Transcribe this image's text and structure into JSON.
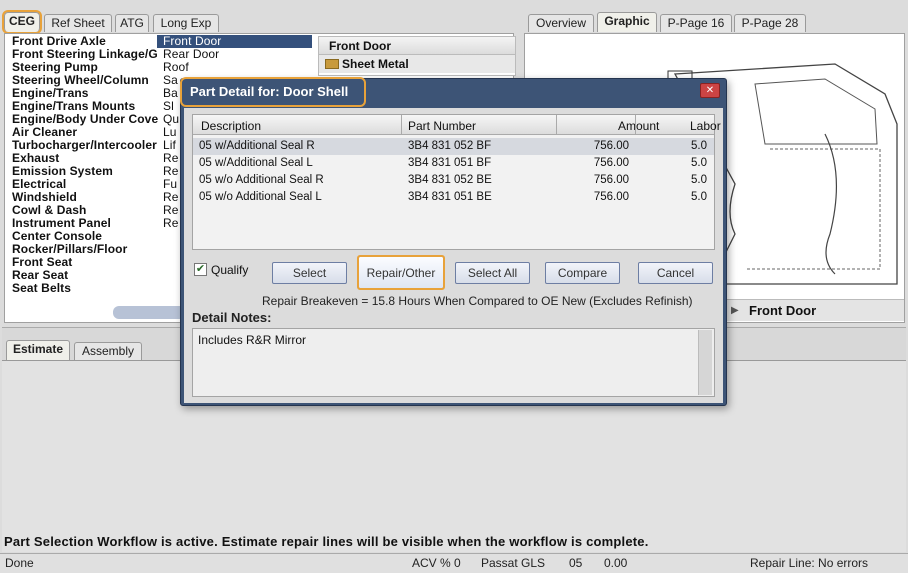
{
  "top_tabs": [
    "CEG",
    "Ref Sheet",
    "ATG",
    "Long Exp"
  ],
  "view_tabs": [
    "Overview",
    "Graphic",
    "P-Page 16",
    "P-Page 28"
  ],
  "categories": [
    "Front Drive Axle",
    "Front Steering Linkage/G",
    "Steering Pump",
    "Steering Wheel/Column",
    "Engine/Trans",
    "Engine/Trans Mounts",
    "Engine/Body Under Cove",
    "Air Cleaner",
    "Turbocharger/Intercooler",
    "Exhaust",
    "Emission System",
    "Electrical",
    "Windshield",
    "Cowl & Dash",
    "Instrument Panel",
    "Center Console",
    "Rocker/Pillars/Floor",
    "Front Seat",
    "Rear Seat",
    "Seat Belts"
  ],
  "subcategories": [
    "Front Door",
    "Rear Door",
    "Roof",
    "Sa",
    "Ba",
    "Sl",
    "Qu",
    "Lu",
    "Lif",
    "Re",
    "Re",
    "Fu",
    "Re",
    "Re",
    "Re"
  ],
  "tree": {
    "header": "Front Door",
    "item": "Sheet Metal"
  },
  "graphic": {
    "caption": "Front Door"
  },
  "bottom_tabs": [
    "Estimate",
    "Assembly"
  ],
  "workflow_message": "Part Selection Workflow is active. Estimate repair lines will be visible when the workflow is complete.",
  "status": {
    "left": "Done",
    "acv": "ACV % 0",
    "model": "Passat GLS",
    "year": "05",
    "amount": "0.00",
    "repair": "Repair Line: No errors"
  },
  "dialog": {
    "title": "Part Detail for: Door Shell",
    "columns": [
      "Description",
      "Part Number",
      "Amount",
      "Labor"
    ],
    "rows": [
      {
        "desc": "05 w/Additional Seal R",
        "part": "3B4 831 052 BF",
        "amount": "756.00",
        "labor": "5.0"
      },
      {
        "desc": "05 w/Additional Seal L",
        "part": "3B4 831 051 BF",
        "amount": "756.00",
        "labor": "5.0"
      },
      {
        "desc": "05 w/o Additional Seal R",
        "part": "3B4 831 052 BE",
        "amount": "756.00",
        "labor": "5.0"
      },
      {
        "desc": "05 w/o Additional Seal L",
        "part": "3B4 831 051 BE",
        "amount": "756.00",
        "labor": "5.0"
      }
    ],
    "qualify_label": "Qualify",
    "buttons": {
      "select": "Select",
      "repair": "Repair/Other",
      "select_all": "Select All",
      "compare": "Compare",
      "cancel": "Cancel"
    },
    "breakeven": "Repair Breakeven = 15.8 Hours When Compared to OE New  (Excludes Refinish)",
    "notes_label": "Detail Notes:",
    "notes": "Includes R&R Mirror",
    "close": "✕"
  }
}
